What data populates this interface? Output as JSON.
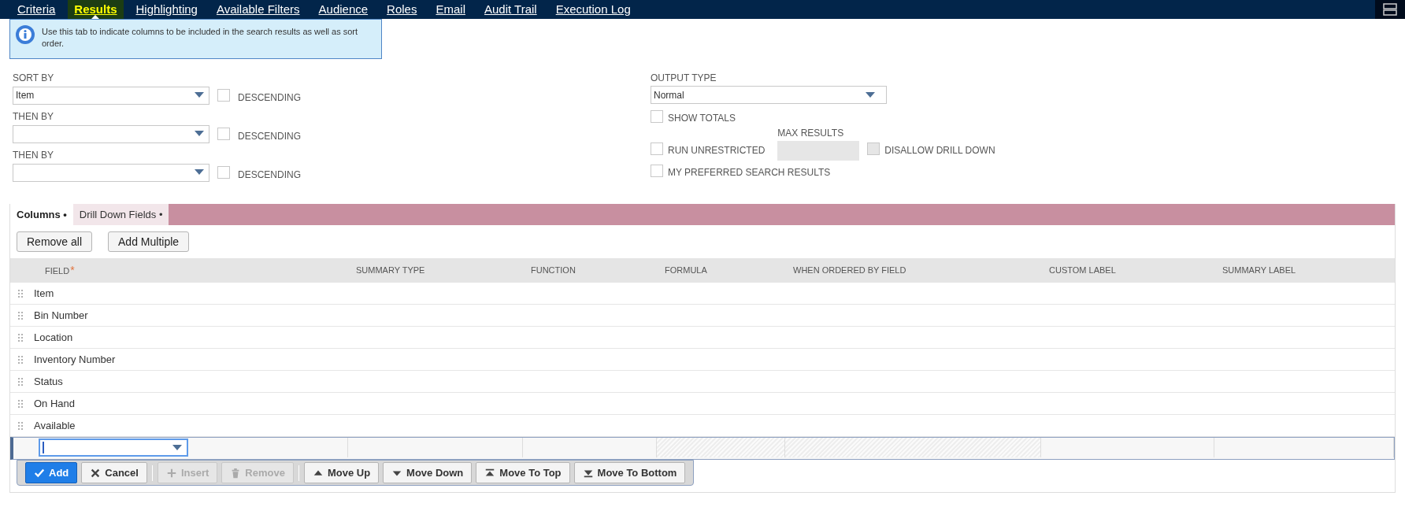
{
  "tabs": [
    {
      "label": "Criteria",
      "selected": false
    },
    {
      "label": "Results",
      "selected": true
    },
    {
      "label": "Highlighting",
      "selected": false
    },
    {
      "label": "Available Filters",
      "selected": false
    },
    {
      "label": "Audience",
      "selected": false
    },
    {
      "label": "Roles",
      "selected": false
    },
    {
      "label": "Email",
      "selected": false
    },
    {
      "label": "Audit Trail",
      "selected": false
    },
    {
      "label": "Execution Log",
      "selected": false
    }
  ],
  "info": "Use this tab to indicate columns to be included in the search results as well as sort order.",
  "sort": [
    {
      "label": "SORT BY",
      "value": "Item",
      "descending_label": "DESCENDING",
      "descending": false
    },
    {
      "label": "THEN BY",
      "descending_label": "DESCENDING",
      "descending": false
    },
    {
      "label": "THEN BY",
      "descending_label": "DESCENDING",
      "descending": false
    }
  ],
  "output": {
    "label": "OUTPUT TYPE",
    "value": "Normal",
    "show_totals": {
      "label": "SHOW TOTALS",
      "checked": false
    },
    "max_results_label": "MAX RESULTS",
    "run_unrestricted": {
      "label": "RUN UNRESTRICTED",
      "checked": false
    },
    "disallow_drill_down": {
      "label": "DISALLOW DRILL DOWN",
      "checked": false,
      "disabled": true
    },
    "preferred": {
      "label": "MY PREFERRED SEARCH RESULTS",
      "checked": false
    }
  },
  "subtabs": [
    {
      "label": "Columns •",
      "selected": true
    },
    {
      "label": "Drill Down Fields •",
      "selected": false
    }
  ],
  "list_buttons": [
    "Remove all",
    "Add Multiple"
  ],
  "table": {
    "columns": [
      "FIELD",
      "SUMMARY TYPE",
      "FUNCTION",
      "FORMULA",
      "WHEN ORDERED BY FIELD",
      "CUSTOM LABEL",
      "SUMMARY LABEL"
    ],
    "required_mark": "*",
    "rows": [
      "Item",
      "Bin Number",
      "Location",
      "Inventory Number",
      "Status",
      "On Hand",
      "Available"
    ]
  },
  "row_actions": [
    {
      "kind": "add",
      "label": "Add",
      "disabled": false
    },
    {
      "kind": "cancel",
      "label": "Cancel",
      "disabled": false
    },
    {
      "kind": "separator"
    },
    {
      "kind": "insert",
      "label": "Insert",
      "disabled": true
    },
    {
      "kind": "remove",
      "label": "Remove",
      "disabled": true
    },
    {
      "kind": "separator"
    },
    {
      "kind": "move_up",
      "label": "Move Up",
      "disabled": false
    },
    {
      "kind": "move_down",
      "label": "Move Down",
      "disabled": false
    },
    {
      "kind": "move_top",
      "label": "Move To Top",
      "disabled": false
    },
    {
      "kind": "move_bottom",
      "label": "Move To Bottom",
      "disabled": false
    }
  ]
}
